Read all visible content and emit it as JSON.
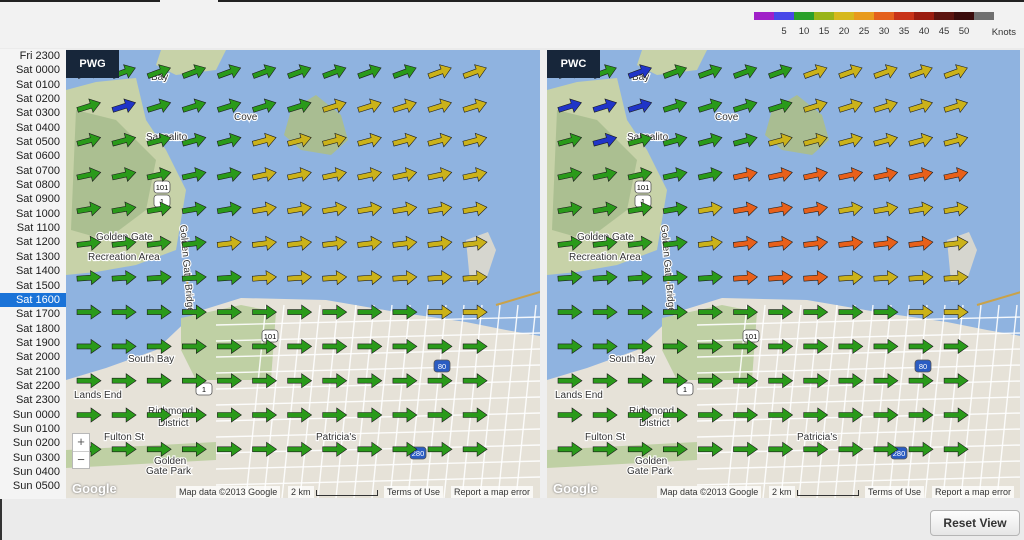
{
  "legend": {
    "colors": [
      "#a020c8",
      "#4848e8",
      "#2aa02a",
      "#98b418",
      "#d6b81c",
      "#e89a1c",
      "#e4601c",
      "#c83218",
      "#9a1c10",
      "#5c1410",
      "#3a0c0c",
      "#707070"
    ],
    "labels": [
      "5",
      "10",
      "15",
      "20",
      "25",
      "30",
      "35",
      "40",
      "45",
      "50"
    ],
    "unit": "Knots"
  },
  "timeline": {
    "items": [
      "Fri 2300",
      "Sat 0000",
      "Sat 0100",
      "Sat 0200",
      "Sat 0300",
      "Sat 0400",
      "Sat 0500",
      "Sat 0600",
      "Sat 0700",
      "Sat 0800",
      "Sat 0900",
      "Sat 1000",
      "Sat 1100",
      "Sat 1200",
      "Sat 1300",
      "Sat 1400",
      "Sat 1500",
      "Sat 1600",
      "Sat 1700",
      "Sat 1800",
      "Sat 1900",
      "Sat 2000",
      "Sat 2100",
      "Sat 2200",
      "Sat 2300",
      "Sun 0000",
      "Sun 0100",
      "Sun 0200",
      "Sun 0300",
      "Sun 0400",
      "Sun 0500"
    ],
    "selected": "Sat 1600"
  },
  "panels": [
    {
      "label": "PWG",
      "rows": [
        "ggggggggggyy",
        "gbgggggyyyyy",
        "gggggyyyyyyy",
        "gggggyyyyyyy",
        "gggggyyyyyyy",
        "ggggyyyyyyyy",
        "gggggyyyyyyy",
        "ggggggggggyy",
        "gggggggggggg",
        "gggggggggggg",
        "gggggggggggg",
        "gggggggggggg"
      ]
    },
    {
      "label": "PWC",
      "rows": [
        "ggbggggyyyyy",
        "bbbggggyyyyy",
        "gbggggyyyyyy",
        "gggggooooooo",
        "ggggyoooyyyy",
        "ggggyooooooy",
        "gggggoooyyyy",
        "ggggggggggyy",
        "gggggggggggg",
        "gggggggggggg",
        "gggggggggggg",
        "gggggggggggg"
      ]
    }
  ],
  "arrow_colors": {
    "g": "#2a9a1a",
    "y": "#cbb21a",
    "o": "#e8601a",
    "b": "#2035c8"
  },
  "place_labels": {
    "bay": "Bay",
    "cove": "Cove",
    "sausalito": "Sausalito",
    "ggnra1": "Golden Gate",
    "ggnra2": "Recreation Area",
    "bridge": "Golden Gate Bridge",
    "south_bay": "South Bay",
    "lands_end": "Lands End",
    "richmond1": "Richmond",
    "richmond2": "District",
    "patricia": "Patricia's",
    "fulton": "Fulton St",
    "ggpark1": "Golden",
    "ggpark2": "Gate Park",
    "rt101a": "101",
    "rt101b": "101",
    "rt1": "1",
    "rt80": "80",
    "rt280": "280"
  },
  "map_attribution": {
    "map_data": "Map data ©2013 Google",
    "scale": "2 km",
    "terms": "Terms of Use",
    "report": "Report a map error",
    "logo": "Google"
  },
  "zoom": {
    "in": "+",
    "out": "−"
  },
  "reset_button": "Reset View"
}
